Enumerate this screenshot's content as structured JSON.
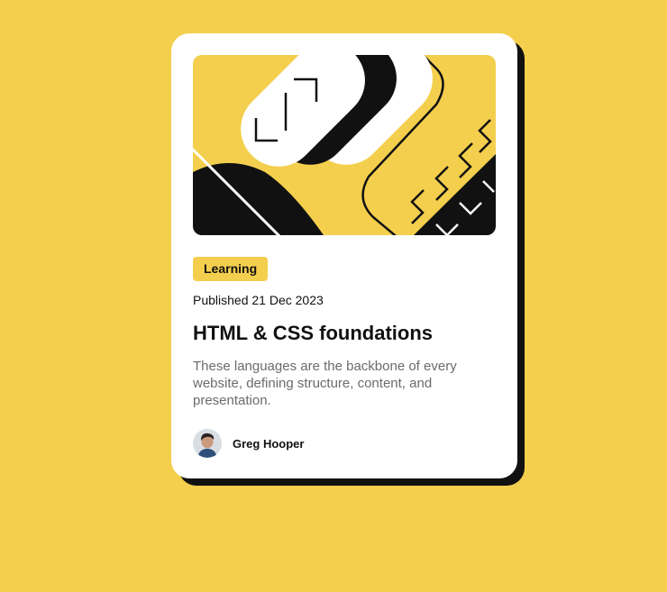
{
  "colors": {
    "page_background": "#F4CF4D",
    "card_background": "#FFFFFF",
    "shadow": "#111111",
    "tag_background": "#F4CF4D",
    "text_primary": "#111111",
    "text_secondary": "#6B6B6B"
  },
  "card": {
    "image_icon": "abstract-illustration",
    "tag": "Learning",
    "published": "Published 21 Dec 2023",
    "title": "HTML & CSS foundations",
    "description": "These languages are the backbone of every website, defining structure, content, and presentation.",
    "author": {
      "avatar_icon": "avatar-photo",
      "name": "Greg Hooper"
    }
  }
}
